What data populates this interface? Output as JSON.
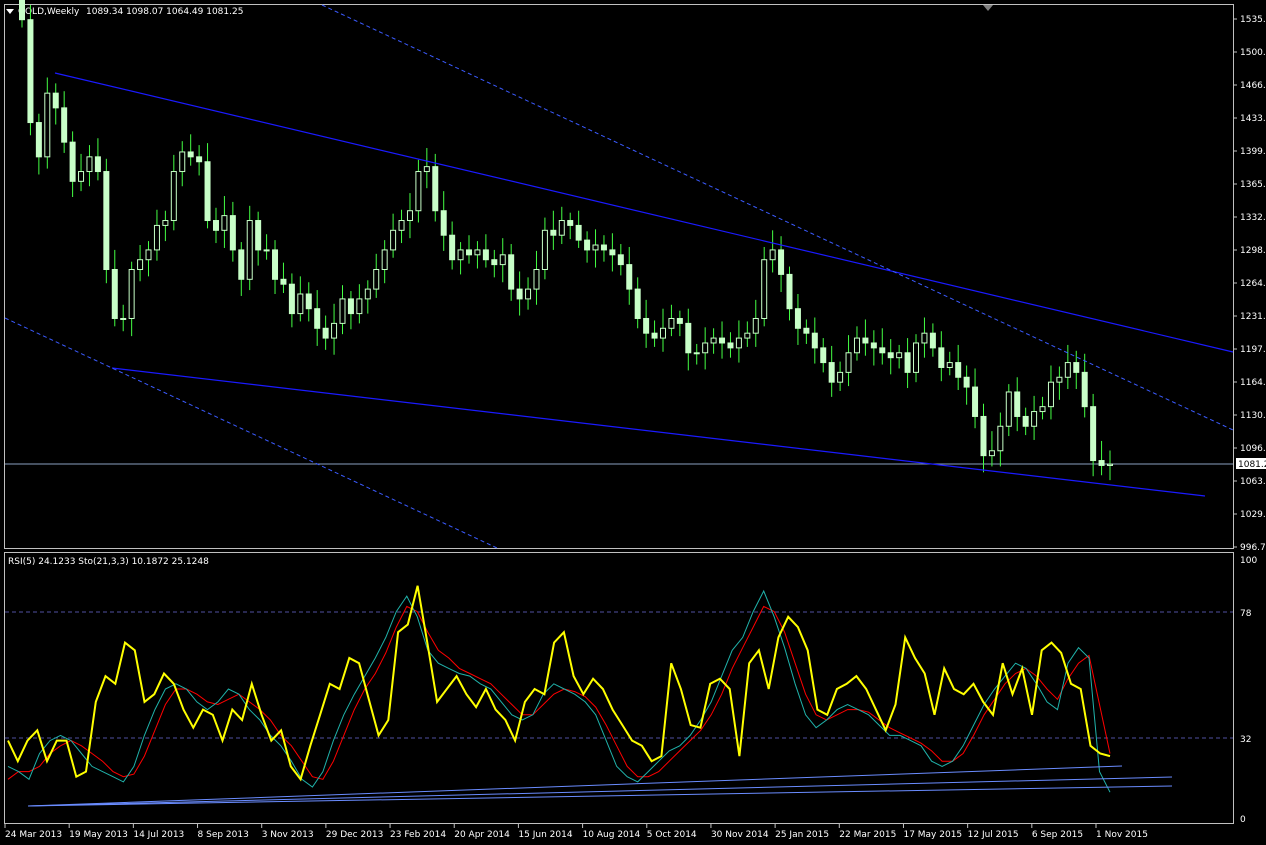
{
  "price_panel": {
    "symbol_timeframe": "GOLD,Weekly",
    "ohlc": "1089.34 1098.07 1064.49 1081.25",
    "current_price_label": "1081.25",
    "price_ticks": [
      "1535.7",
      "1500.7",
      "1466.7",
      "1433.7",
      "1399.7",
      "1365.7",
      "1332.7",
      "1298.7",
      "1264.7",
      "1231.7",
      "1197.7",
      "1164.7",
      "1130.7",
      "1096.7",
      "1063.7",
      "1029.7",
      "996.75"
    ]
  },
  "indicator_panel": {
    "header": "RSI(5) 24.1233  Sto(21,3,3) 10.1872 25.1248",
    "level_ticks": [
      "100",
      "78",
      "32",
      "0"
    ]
  },
  "time_axis": {
    "labels": [
      "24 Mar 2013",
      "19 May 2013",
      "14 Jul 2013",
      "8 Sep 2013",
      "3 Nov 2013",
      "29 Dec 2013",
      "23 Feb 2014",
      "20 Apr 2014",
      "15 Jun 2014",
      "10 Aug 2014",
      "5 Oct 2014",
      "30 Nov 2014",
      "25 Jan 2015",
      "22 Mar 2015",
      "17 May 2015",
      "12 Jul 2015",
      "6 Sep 2015",
      "1 Nov 2015"
    ]
  },
  "colors": {
    "background": "#000000",
    "frame": "#c0c0c0",
    "candle": "#c8ffc8",
    "wick": "#44ff44",
    "trend": "#1a1aff",
    "trend_dashed": "#3b5bff",
    "price_line": "#8aa0c0",
    "rsi": "#ffff00",
    "stoch_main": "#20b2aa",
    "stoch_signal": "#ff0000",
    "level": "#5050a0",
    "indicator_trend": "#6a8cff"
  },
  "chart_data": [
    {
      "type": "candlestick",
      "title": "GOLD,Weekly",
      "y_range": [
        996.75,
        1550
      ],
      "trendlines_price": [
        {
          "style": "solid",
          "from": {
            "x": "14 Apr 2013",
            "y": 1482
          },
          "to": {
            "x": "29 Nov 2015",
            "y": 1062
          }
        },
        {
          "style": "solid",
          "from": {
            "x": "14 Apr 2013",
            "y": 1178
          },
          "to": {
            "x": "29 Nov 2015",
            "y": 1062
          }
        },
        {
          "style": "solid",
          "from": {
            "x": "14 Apr 2013",
            "y": 1482
          },
          "to": {
            "x": "Jan 2016",
            "y": 1195
          }
        },
        {
          "style": "dashed",
          "from": {
            "x": "Feb 2013",
            "y": 1565
          },
          "to": {
            "x": "Jan 2016",
            "y": 1118
          }
        },
        {
          "style": "dashed",
          "from": {
            "x": "Mar 2013",
            "y": 1229
          },
          "to": {
            "x": "May 2014",
            "y": 995
          }
        }
      ],
      "horizontal_line": 1081.25,
      "close_series_approx": [
        1535,
        1430,
        1395,
        1460,
        1445,
        1410,
        1370,
        1380,
        1395,
        1380,
        1280,
        1230,
        1230,
        1280,
        1290,
        1300,
        1325,
        1330,
        1380,
        1400,
        1395,
        1390,
        1330,
        1320,
        1335,
        1300,
        1270,
        1330,
        1300,
        1300,
        1270,
        1265,
        1235,
        1255,
        1240,
        1220,
        1210,
        1225,
        1250,
        1235,
        1250,
        1260,
        1280,
        1300,
        1320,
        1330,
        1340,
        1380,
        1385,
        1340,
        1315,
        1290,
        1300,
        1295,
        1300,
        1290,
        1285,
        1295,
        1260,
        1250,
        1260,
        1280,
        1320,
        1315,
        1330,
        1325,
        1310,
        1300,
        1305,
        1300,
        1295,
        1285,
        1260,
        1230,
        1215,
        1210,
        1220,
        1230,
        1225,
        1195,
        1195,
        1205,
        1210,
        1205,
        1200,
        1210,
        1215,
        1230,
        1290,
        1300,
        1275,
        1240,
        1220,
        1215,
        1200,
        1185,
        1165,
        1175,
        1195,
        1210,
        1205,
        1200,
        1195,
        1190,
        1195,
        1175,
        1205,
        1215,
        1200,
        1180,
        1185,
        1170,
        1160,
        1130,
        1090,
        1095,
        1120,
        1155,
        1130,
        1120,
        1135,
        1140,
        1165,
        1170,
        1185,
        1175,
        1140,
        1085,
        1080,
        1081.25
      ]
    },
    {
      "type": "line",
      "title": "RSI(5) 24.1233  Sto(21,3,3) 10.1872 25.1248",
      "y_range": [
        0,
        100
      ],
      "levels": [
        32,
        78
      ],
      "series": [
        {
          "name": "RSI(5)",
          "values": [
            30,
            22,
            30,
            34,
            22,
            30,
            30,
            16,
            18,
            45,
            55,
            52,
            68,
            65,
            45,
            48,
            56,
            52,
            42,
            35,
            42,
            40,
            30,
            42,
            38,
            52,
            40,
            30,
            34,
            20,
            15,
            28,
            40,
            52,
            50,
            62,
            60,
            46,
            32,
            38,
            72,
            75,
            90,
            68,
            45,
            50,
            55,
            48,
            43,
            50,
            42,
            38,
            30,
            45,
            50,
            48,
            68,
            72,
            55,
            48,
            54,
            50,
            42,
            36,
            30,
            28,
            22,
            24,
            60,
            50,
            36,
            35,
            52,
            54,
            50,
            24,
            60,
            65,
            50,
            70,
            78,
            74,
            65,
            42,
            40,
            50,
            52,
            55,
            50,
            42,
            34,
            44,
            70,
            62,
            56,
            40,
            58,
            50,
            48,
            52,
            45,
            40,
            60,
            48,
            58,
            40,
            65,
            68,
            64,
            52,
            50,
            28,
            25,
            24
          ]
        },
        {
          "name": "Sto main",
          "values": [
            20,
            18,
            15,
            25,
            30,
            32,
            30,
            25,
            20,
            18,
            16,
            14,
            20,
            32,
            42,
            50,
            52,
            50,
            45,
            42,
            45,
            50,
            48,
            42,
            38,
            32,
            28,
            22,
            15,
            12,
            18,
            30,
            40,
            48,
            55,
            62,
            70,
            80,
            86,
            78,
            65,
            60,
            58,
            56,
            55,
            52,
            50,
            45,
            40,
            38,
            40,
            48,
            52,
            50,
            48,
            45,
            40,
            30,
            20,
            16,
            14,
            18,
            22,
            26,
            28,
            32,
            38,
            45,
            55,
            65,
            70,
            80,
            88,
            78,
            66,
            52,
            40,
            35,
            38,
            42,
            44,
            42,
            40,
            36,
            32,
            32,
            30,
            28,
            22,
            20,
            22,
            28,
            36,
            44,
            50,
            55,
            60,
            58,
            52,
            45,
            42,
            60,
            66,
            62,
            18,
            10
          ]
        },
        {
          "name": "Sto signal",
          "values": [
            15,
            18,
            18,
            20,
            25,
            28,
            30,
            28,
            25,
            22,
            18,
            16,
            17,
            24,
            34,
            44,
            50,
            50,
            48,
            45,
            44,
            46,
            48,
            45,
            42,
            38,
            32,
            28,
            22,
            16,
            15,
            22,
            32,
            42,
            50,
            56,
            64,
            74,
            82,
            80,
            72,
            65,
            62,
            58,
            56,
            54,
            52,
            48,
            44,
            40,
            40,
            44,
            48,
            50,
            49,
            47,
            43,
            36,
            28,
            20,
            16,
            16,
            18,
            22,
            26,
            30,
            34,
            40,
            48,
            58,
            66,
            74,
            82,
            80,
            72,
            60,
            48,
            40,
            38,
            40,
            42,
            42,
            41,
            38,
            35,
            33,
            31,
            29,
            26,
            22,
            22,
            25,
            32,
            40,
            46,
            52,
            56,
            58,
            55,
            50,
            46,
            54,
            60,
            63,
            44,
            25
          ]
        }
      ]
    }
  ]
}
